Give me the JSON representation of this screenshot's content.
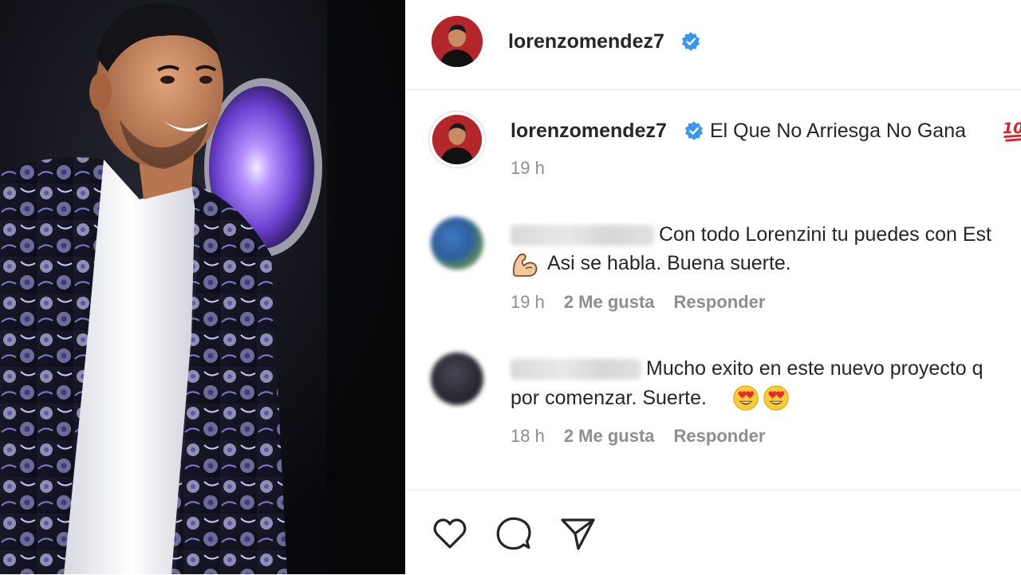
{
  "post": {
    "username": "lorenzomendez7",
    "verified_icon": "verified-badge-icon",
    "caption": {
      "text": "El Que No Arriesga No Gana",
      "emoji": "hundred-points-emoji",
      "time": "19 h"
    }
  },
  "comments": [
    {
      "text_line1": "Con todo Lorenzini tu puedes con Est",
      "text_line2": "Asi se habla. Buena suerte.",
      "emoji": "flexed-biceps-emoji",
      "time": "19 h",
      "likes": "2 Me gusta",
      "reply": "Responder"
    },
    {
      "text_line1": "Mucho exito en este nuevo proyecto q",
      "text_line2": "por comenzar. Suerte.",
      "emoji": "heart-eyes-emoji",
      "time": "18 h",
      "likes": "2 Me gusta",
      "reply": "Responder"
    }
  ],
  "actions": {
    "like_icon": "heart-icon",
    "comment_icon": "comment-bubble-icon",
    "share_icon": "paper-plane-icon"
  },
  "colors": {
    "verified_blue": "#3897f0",
    "text": "#262626",
    "secondary_text": "#8e8e8e",
    "divider": "#e6e6e6"
  }
}
